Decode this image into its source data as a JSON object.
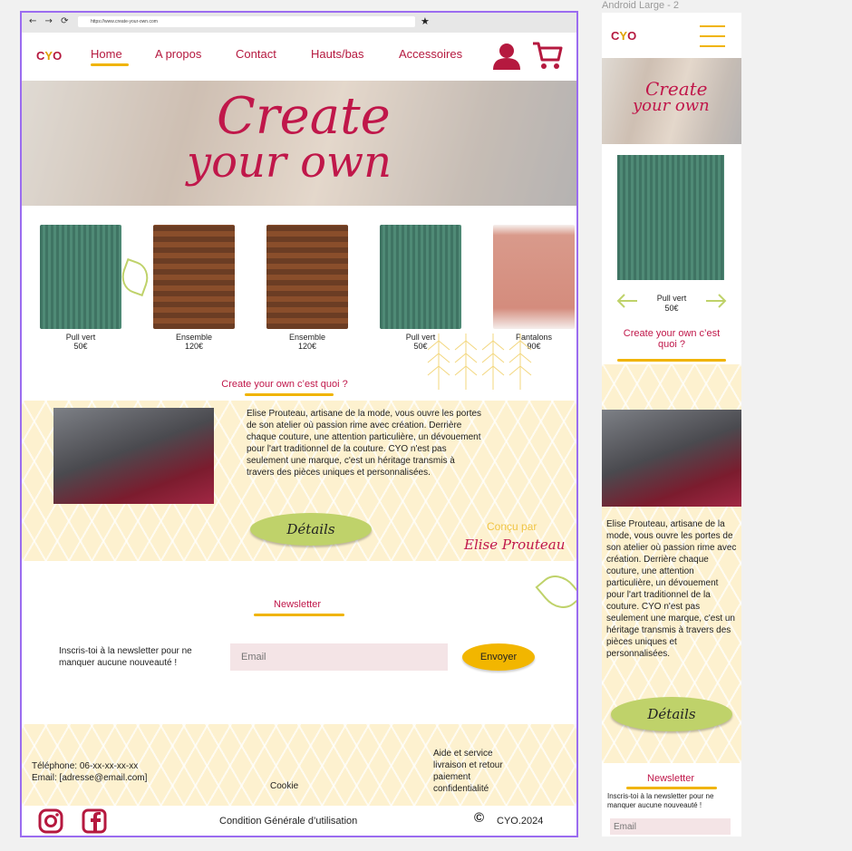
{
  "canvas": {
    "frame_label": "Android Large - 2"
  },
  "browser": {
    "nav": "← → ⟳",
    "url": "https://www.create-your-own.com",
    "bookmark_icon": "★"
  },
  "brand": {
    "logo_c": "C",
    "logo_y": "Y",
    "logo_o": "O",
    "primary_color": "#b5193f",
    "accent_color": "#f0b400",
    "green_color": "#bfd26a"
  },
  "nav": {
    "items": [
      {
        "label": "Home"
      },
      {
        "label": "A propos"
      },
      {
        "label": "Contact"
      },
      {
        "label": "Hauts/bas"
      },
      {
        "label": "Accessoires"
      }
    ]
  },
  "hero": {
    "line1": "Create",
    "line2": "your own"
  },
  "products": [
    {
      "name": "Pull vert",
      "price": "50€"
    },
    {
      "name": "Ensemble",
      "price": "120€"
    },
    {
      "name": "Ensemble",
      "price": "120€"
    },
    {
      "name": "Pull vert",
      "price": "50€"
    },
    {
      "name": "Pantalons",
      "price": "90€"
    }
  ],
  "about": {
    "title": "Create your own c’est quoi ?",
    "text": "Elise Prouteau, artisane de la mode, vous ouvre les portes de son atelier où passion rime avec création. Derrière chaque couture, une attention particulière, un dévouement pour l'art traditionnel de la couture. CYO n'est pas seulement une marque, c'est un héritage transmis à travers des pièces uniques et personnalisées.",
    "button": "Détails",
    "designed_by": "Conçu par",
    "designer": "Elise Prouteau"
  },
  "newsletter": {
    "title": "Newsletter",
    "text": "Inscris-toi à la newsletter pour ne manquer aucune nouveauté !",
    "placeholder": "Email",
    "button": "Envoyer"
  },
  "footer": {
    "phone": "Téléphone: 06-xx-xx-xx-xx",
    "email": "Email: [adresse@email.com]",
    "cookie": "Cookie",
    "help": [
      "Aide et service",
      "livraison et retour",
      "paiement",
      "confidentialité"
    ],
    "cgu": "Condition Générale d’utilisation",
    "copyright_symbol": "©",
    "copyright": "CYO.2024"
  },
  "mobile": {
    "product": {
      "name": "Pull vert",
      "price": "50€"
    },
    "about_title": "Create your own c’est quoi ?",
    "about_text": "Elise Prouteau, artisane de la mode, vous ouvre les portes de son atelier où passion rime avec création. Derrière chaque couture, une attention particulière, un dévouement pour l'art traditionnel de la couture. CYO n'est pas seulement une marque, c'est un héritage transmis à travers des pièces uniques et personnalisées.",
    "button": "Détails",
    "newsletter_title": "Newsletter",
    "newsletter_text": "Inscris-toi à la newsletter pour ne manquer aucune nouveauté !",
    "email_placeholder": "Email"
  }
}
